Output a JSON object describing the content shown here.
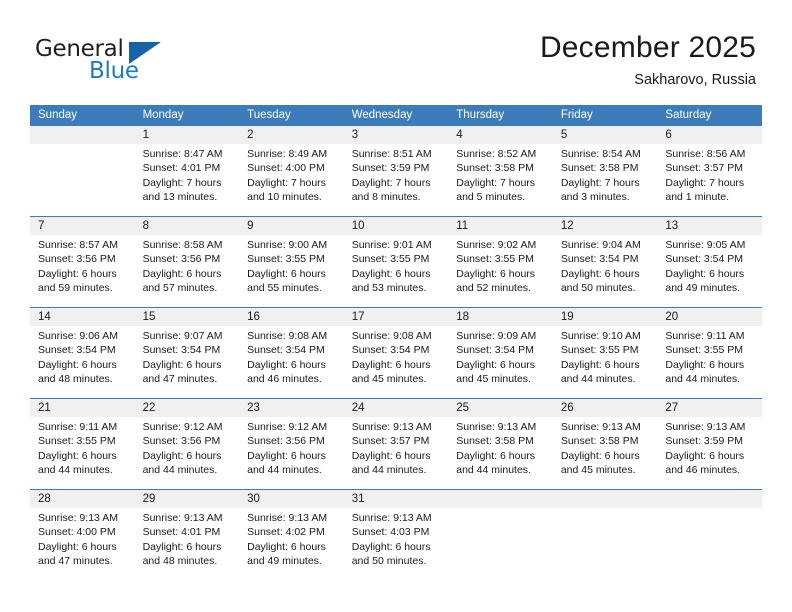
{
  "brand": {
    "name_top": "General",
    "name_bottom": "Blue",
    "accent_color": "#1763a8",
    "text_color": "#231f20"
  },
  "header": {
    "title": "December 2025",
    "location": "Sakharovo, Russia"
  },
  "calendar": {
    "header_bg": "#3d7cba",
    "daynum_bg": "#f0f0f0",
    "weekdays": [
      "Sunday",
      "Monday",
      "Tuesday",
      "Wednesday",
      "Thursday",
      "Friday",
      "Saturday"
    ],
    "weeks": [
      [
        {
          "day": "",
          "sunrise": "",
          "sunset": "",
          "daylight": ""
        },
        {
          "day": "1",
          "sunrise": "Sunrise: 8:47 AM",
          "sunset": "Sunset: 4:01 PM",
          "daylight": "Daylight: 7 hours and 13 minutes."
        },
        {
          "day": "2",
          "sunrise": "Sunrise: 8:49 AM",
          "sunset": "Sunset: 4:00 PM",
          "daylight": "Daylight: 7 hours and 10 minutes."
        },
        {
          "day": "3",
          "sunrise": "Sunrise: 8:51 AM",
          "sunset": "Sunset: 3:59 PM",
          "daylight": "Daylight: 7 hours and 8 minutes."
        },
        {
          "day": "4",
          "sunrise": "Sunrise: 8:52 AM",
          "sunset": "Sunset: 3:58 PM",
          "daylight": "Daylight: 7 hours and 5 minutes."
        },
        {
          "day": "5",
          "sunrise": "Sunrise: 8:54 AM",
          "sunset": "Sunset: 3:58 PM",
          "daylight": "Daylight: 7 hours and 3 minutes."
        },
        {
          "day": "6",
          "sunrise": "Sunrise: 8:56 AM",
          "sunset": "Sunset: 3:57 PM",
          "daylight": "Daylight: 7 hours and 1 minute."
        }
      ],
      [
        {
          "day": "7",
          "sunrise": "Sunrise: 8:57 AM",
          "sunset": "Sunset: 3:56 PM",
          "daylight": "Daylight: 6 hours and 59 minutes."
        },
        {
          "day": "8",
          "sunrise": "Sunrise: 8:58 AM",
          "sunset": "Sunset: 3:56 PM",
          "daylight": "Daylight: 6 hours and 57 minutes."
        },
        {
          "day": "9",
          "sunrise": "Sunrise: 9:00 AM",
          "sunset": "Sunset: 3:55 PM",
          "daylight": "Daylight: 6 hours and 55 minutes."
        },
        {
          "day": "10",
          "sunrise": "Sunrise: 9:01 AM",
          "sunset": "Sunset: 3:55 PM",
          "daylight": "Daylight: 6 hours and 53 minutes."
        },
        {
          "day": "11",
          "sunrise": "Sunrise: 9:02 AM",
          "sunset": "Sunset: 3:55 PM",
          "daylight": "Daylight: 6 hours and 52 minutes."
        },
        {
          "day": "12",
          "sunrise": "Sunrise: 9:04 AM",
          "sunset": "Sunset: 3:54 PM",
          "daylight": "Daylight: 6 hours and 50 minutes."
        },
        {
          "day": "13",
          "sunrise": "Sunrise: 9:05 AM",
          "sunset": "Sunset: 3:54 PM",
          "daylight": "Daylight: 6 hours and 49 minutes."
        }
      ],
      [
        {
          "day": "14",
          "sunrise": "Sunrise: 9:06 AM",
          "sunset": "Sunset: 3:54 PM",
          "daylight": "Daylight: 6 hours and 48 minutes."
        },
        {
          "day": "15",
          "sunrise": "Sunrise: 9:07 AM",
          "sunset": "Sunset: 3:54 PM",
          "daylight": "Daylight: 6 hours and 47 minutes."
        },
        {
          "day": "16",
          "sunrise": "Sunrise: 9:08 AM",
          "sunset": "Sunset: 3:54 PM",
          "daylight": "Daylight: 6 hours and 46 minutes."
        },
        {
          "day": "17",
          "sunrise": "Sunrise: 9:08 AM",
          "sunset": "Sunset: 3:54 PM",
          "daylight": "Daylight: 6 hours and 45 minutes."
        },
        {
          "day": "18",
          "sunrise": "Sunrise: 9:09 AM",
          "sunset": "Sunset: 3:54 PM",
          "daylight": "Daylight: 6 hours and 45 minutes."
        },
        {
          "day": "19",
          "sunrise": "Sunrise: 9:10 AM",
          "sunset": "Sunset: 3:55 PM",
          "daylight": "Daylight: 6 hours and 44 minutes."
        },
        {
          "day": "20",
          "sunrise": "Sunrise: 9:11 AM",
          "sunset": "Sunset: 3:55 PM",
          "daylight": "Daylight: 6 hours and 44 minutes."
        }
      ],
      [
        {
          "day": "21",
          "sunrise": "Sunrise: 9:11 AM",
          "sunset": "Sunset: 3:55 PM",
          "daylight": "Daylight: 6 hours and 44 minutes."
        },
        {
          "day": "22",
          "sunrise": "Sunrise: 9:12 AM",
          "sunset": "Sunset: 3:56 PM",
          "daylight": "Daylight: 6 hours and 44 minutes."
        },
        {
          "day": "23",
          "sunrise": "Sunrise: 9:12 AM",
          "sunset": "Sunset: 3:56 PM",
          "daylight": "Daylight: 6 hours and 44 minutes."
        },
        {
          "day": "24",
          "sunrise": "Sunrise: 9:13 AM",
          "sunset": "Sunset: 3:57 PM",
          "daylight": "Daylight: 6 hours and 44 minutes."
        },
        {
          "day": "25",
          "sunrise": "Sunrise: 9:13 AM",
          "sunset": "Sunset: 3:58 PM",
          "daylight": "Daylight: 6 hours and 44 minutes."
        },
        {
          "day": "26",
          "sunrise": "Sunrise: 9:13 AM",
          "sunset": "Sunset: 3:58 PM",
          "daylight": "Daylight: 6 hours and 45 minutes."
        },
        {
          "day": "27",
          "sunrise": "Sunrise: 9:13 AM",
          "sunset": "Sunset: 3:59 PM",
          "daylight": "Daylight: 6 hours and 46 minutes."
        }
      ],
      [
        {
          "day": "28",
          "sunrise": "Sunrise: 9:13 AM",
          "sunset": "Sunset: 4:00 PM",
          "daylight": "Daylight: 6 hours and 47 minutes."
        },
        {
          "day": "29",
          "sunrise": "Sunrise: 9:13 AM",
          "sunset": "Sunset: 4:01 PM",
          "daylight": "Daylight: 6 hours and 48 minutes."
        },
        {
          "day": "30",
          "sunrise": "Sunrise: 9:13 AM",
          "sunset": "Sunset: 4:02 PM",
          "daylight": "Daylight: 6 hours and 49 minutes."
        },
        {
          "day": "31",
          "sunrise": "Sunrise: 9:13 AM",
          "sunset": "Sunset: 4:03 PM",
          "daylight": "Daylight: 6 hours and 50 minutes."
        },
        {
          "day": "",
          "sunrise": "",
          "sunset": "",
          "daylight": ""
        },
        {
          "day": "",
          "sunrise": "",
          "sunset": "",
          "daylight": ""
        },
        {
          "day": "",
          "sunrise": "",
          "sunset": "",
          "daylight": ""
        }
      ]
    ]
  }
}
